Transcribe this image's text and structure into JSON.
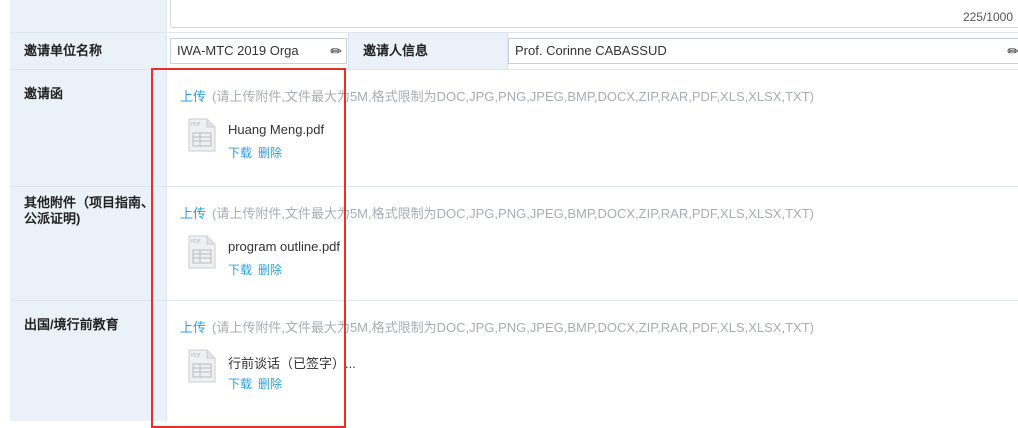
{
  "top_field": {
    "counter": "225/1000"
  },
  "inviter": {
    "org_label": "邀请单位名称",
    "org_value": "IWA-MTC 2019 Orga",
    "person_label": "邀请人信息",
    "person_value": "Prof. Corinne CABASSUD"
  },
  "sections": [
    {
      "label": "邀请函",
      "upload_label": "上传",
      "hint": "(请上传附件,文件最大为5M,格式限制为DOC,JPG,PNG,JPEG,BMP,DOCX,ZIP,RAR,PDF,XLS,XLSX,TXT)",
      "file": {
        "name": "Huang Meng.pdf",
        "download": "下载",
        "delete": "删除",
        "icon": "file-icon"
      }
    },
    {
      "label": "其他附件（项目指南、公派证明)",
      "upload_label": "上传",
      "hint": "(请上传附件,文件最大为5M,格式限制为DOC,JPG,PNG,JPEG,BMP,DOCX,ZIP,RAR,PDF,XLS,XLSX,TXT)",
      "file": {
        "name": "program outline.pdf",
        "download": "下载",
        "delete": "删除",
        "icon": "file-icon"
      }
    },
    {
      "label": "出国/境行前教育",
      "upload_label": "上传",
      "hint": "(请上传附件,文件最大为5M,格式限制为DOC,JPG,PNG,JPEG,BMP,DOCX,ZIP,RAR,PDF,XLS,XLSX,TXT)",
      "file": {
        "name": "行前谈话（已签字）...",
        "download": "下载",
        "delete": "删除",
        "icon": "file-icon"
      }
    }
  ],
  "icons": {
    "edit": "pencil-icon"
  },
  "colors": {
    "link": "#2b9fe0",
    "label_bg": "#eaf1f8",
    "highlight": "#e5302b",
    "hint": "#a8adb3"
  }
}
